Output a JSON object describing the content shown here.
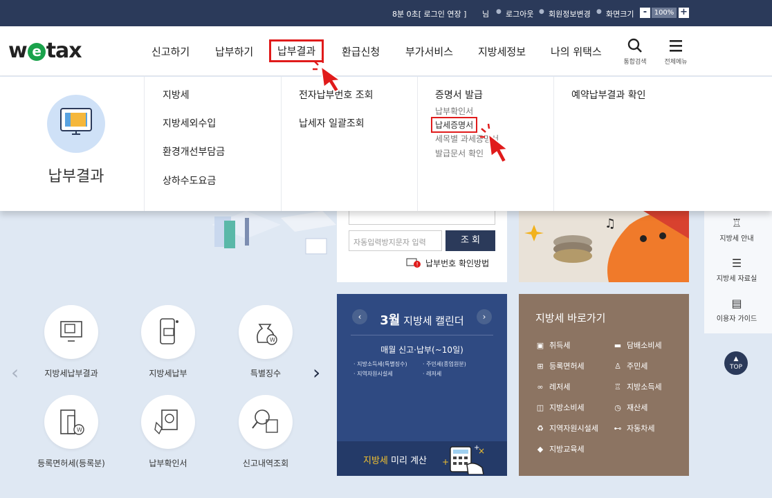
{
  "topbar": {
    "session": "8분 0초[ 로그인 연장 ]",
    "user_suffix": "님",
    "logout": "로그아웃",
    "member_info": "회원정보변경",
    "screen_size": "화면크기",
    "zoom_minus": "-",
    "zoom_value": "100%",
    "zoom_plus": "+"
  },
  "header": {
    "logo_w": "w",
    "logo_e": "e",
    "logo_rest": "tax",
    "nav": [
      "신고하기",
      "납부하기",
      "납부결과",
      "환급신청",
      "부가서비스",
      "지방세정보",
      "나의 위택스"
    ],
    "search_label": "통합검색",
    "menu_label": "전체메뉴"
  },
  "mega_menu": {
    "title": "납부결과",
    "col1": [
      "지방세",
      "지방세외수입",
      "환경개선부담금",
      "상하수도요금"
    ],
    "col2": [
      "전자납부번호 조회",
      "납세자 일괄조회"
    ],
    "col3_title": "증명서 발급",
    "col3_items": [
      "납부확인서",
      "납세증명서",
      "세목별 과세증명서",
      "발급문서 확인"
    ],
    "col4": [
      "예약납부결과 확인"
    ]
  },
  "search": {
    "captcha_placeholder": "자동입력방지문자 입력",
    "search_button": "조 회",
    "how_link": "납부번호 확인방법"
  },
  "quick_menu": [
    {
      "label": "지방세납부결과",
      "icon": "monitor-folder-icon"
    },
    {
      "label": "지방세납부",
      "icon": "phone-pay-icon"
    },
    {
      "label": "특별징수",
      "icon": "money-bag-icon"
    },
    {
      "label": "등록면허세(등록분)",
      "icon": "building-w-icon"
    },
    {
      "label": "납부확인서",
      "icon": "receipt-w-icon"
    },
    {
      "label": "신고내역조회",
      "icon": "magnifier-doc-icon"
    }
  ],
  "calendar": {
    "month": "3월",
    "title": "지방세 캘린더",
    "subtitle": "매월 신고·납부(~10일)",
    "taxes": [
      "지방소득세(특별징수)",
      "주민세(종업원분)",
      "지역자원시설세",
      "레저세"
    ],
    "footer_highlight": "지방세",
    "footer_rest": "미리 계산"
  },
  "shortcuts": {
    "title": "지방세 바로가기",
    "items": [
      "취득세",
      "담배소비세",
      "등록면허세",
      "주민세",
      "레저세",
      "지방소득세",
      "지방소비세",
      "재산세",
      "지역자원시설세",
      "자동차세",
      "지방교육세"
    ]
  },
  "right_panel": {
    "items": [
      "지방세 안내",
      "지방세 자료실",
      "이용자 가이드"
    ],
    "top": "TOP"
  },
  "colors": {
    "accent_navy": "#2b3a5a",
    "highlight_red": "#e01b1b",
    "calendar_blue": "#2f4a82",
    "shortcut_brown": "#8c7462"
  }
}
